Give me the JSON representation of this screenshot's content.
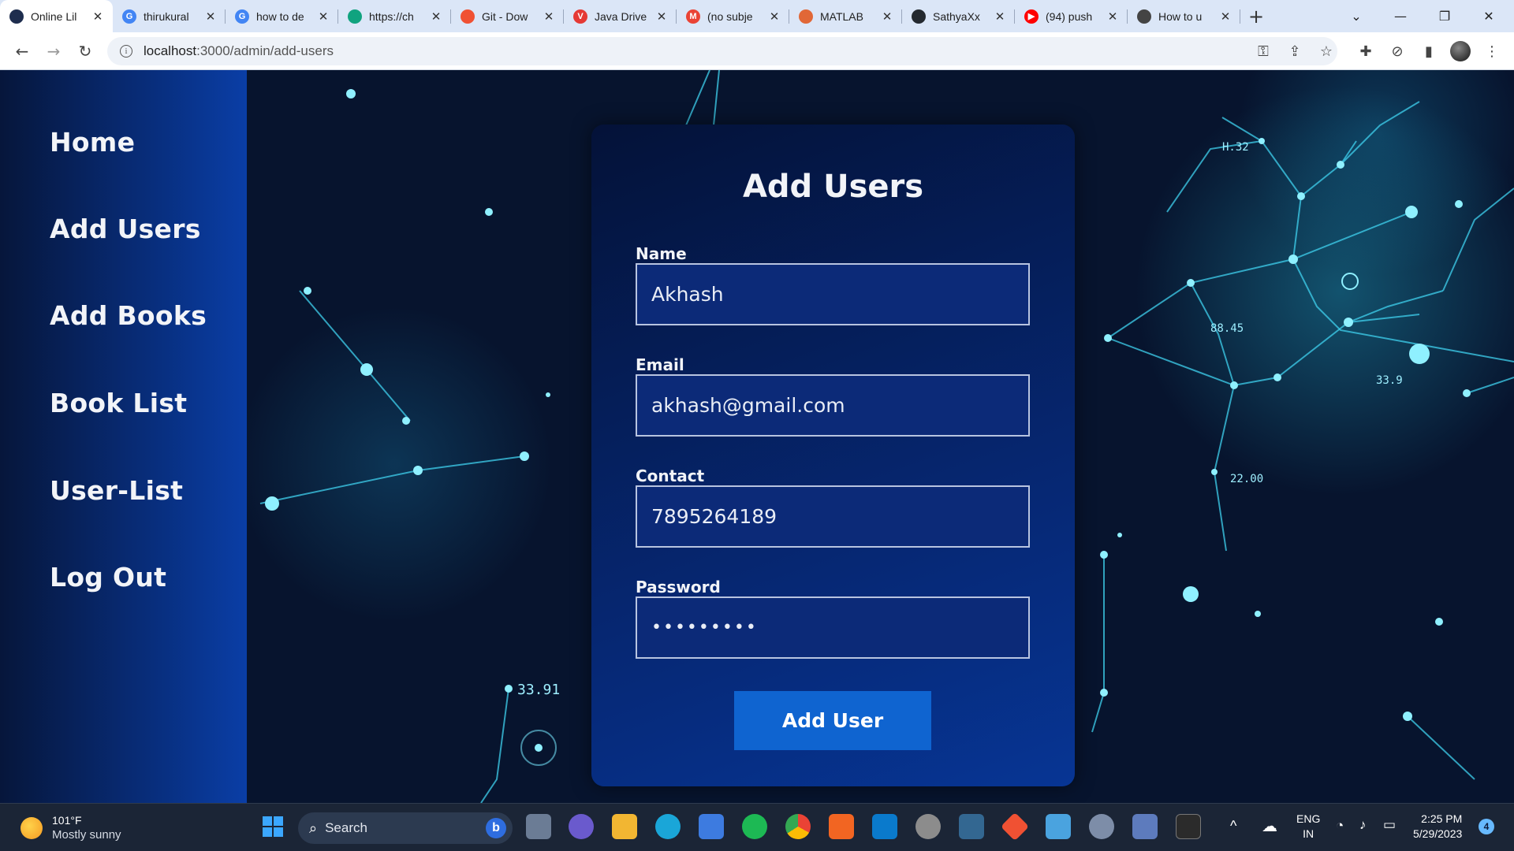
{
  "browser": {
    "tabs": [
      {
        "title": "Online Lil",
        "favicon": "book-favicon",
        "color": "#1e2d4e",
        "glyph": "",
        "active": true
      },
      {
        "title": "thirukural",
        "favicon": "google-favicon",
        "color": "#4285f4",
        "glyph": "G"
      },
      {
        "title": "how to de",
        "favicon": "google-favicon",
        "color": "#4285f4",
        "glyph": "G"
      },
      {
        "title": "https://ch",
        "favicon": "chatgpt-favicon",
        "color": "#10a37f",
        "glyph": ""
      },
      {
        "title": "Git - Dow",
        "favicon": "git-favicon",
        "color": "#f05133",
        "glyph": ""
      },
      {
        "title": "Java Drive",
        "favicon": "vivaldi-favicon",
        "color": "#e53935",
        "glyph": "V"
      },
      {
        "title": "(no subje",
        "favicon": "gmail-favicon",
        "color": "#ea4335",
        "glyph": "M"
      },
      {
        "title": "MATLAB",
        "favicon": "matlab-favicon",
        "color": "#e16737",
        "glyph": ""
      },
      {
        "title": "SathyaXx",
        "favicon": "github-favicon",
        "color": "#24292f",
        "glyph": ""
      },
      {
        "title": "(94) push",
        "favicon": "youtube-favicon",
        "color": "#ff0000",
        "glyph": "▶"
      },
      {
        "title": "How to u",
        "favicon": "openai-favicon",
        "color": "#444444",
        "glyph": ""
      }
    ],
    "new_tab": "+",
    "url_host": "localhost",
    "url_path": ":3000/admin/add-users"
  },
  "sidebar": {
    "items": [
      {
        "label": "Home",
        "name": "sidebar-item-home"
      },
      {
        "label": "Add Users",
        "name": "sidebar-item-add-users"
      },
      {
        "label": "Add Books",
        "name": "sidebar-item-add-books"
      },
      {
        "label": "Book List",
        "name": "sidebar-item-book-list"
      },
      {
        "label": "User-List",
        "name": "sidebar-item-user-list"
      },
      {
        "label": "Log Out",
        "name": "sidebar-item-log-out"
      }
    ]
  },
  "form": {
    "title": "Add Users",
    "name_label": "Name",
    "name_value": "Akhash",
    "email_label": "Email",
    "email_value": "akhash@gmail.com",
    "contact_label": "Contact",
    "contact_value": "7895264189",
    "password_label": "Password",
    "password_value": "•••••••••",
    "submit_label": "Add User"
  },
  "background_readouts": [
    "H.32",
    "88.45",
    "33.9",
    "22.00",
    "33.91"
  ],
  "taskbar": {
    "weather_temp": "101°F",
    "weather_desc": "Mostly sunny",
    "search_placeholder": "Search",
    "bing_glyph": "b",
    "language": "ENG",
    "region": "IN",
    "time": "2:25 PM",
    "date": "5/29/2023",
    "notification_count": "4"
  },
  "colors": {
    "accent_button": "#0f64d0",
    "card_bg": "#062a7a",
    "sidebar_bg": "#082d7a"
  }
}
